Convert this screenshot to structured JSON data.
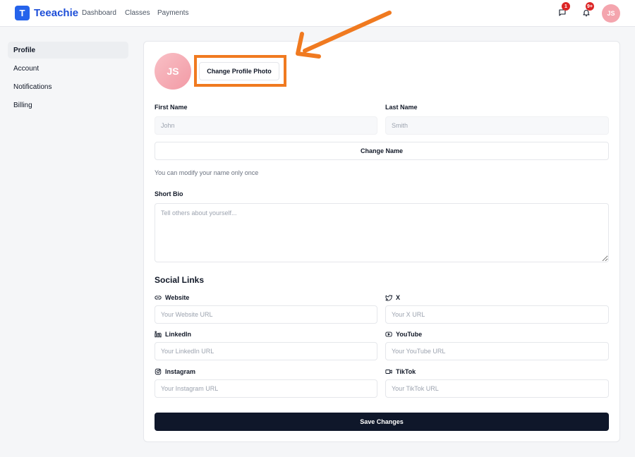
{
  "app": {
    "logo_letter": "T",
    "brand": "Teeachie"
  },
  "nav": {
    "dashboard": "Dashboard",
    "classes": "Classes",
    "payments": "Payments"
  },
  "header": {
    "messages_badge": "1",
    "notifications_badge": "9+",
    "avatar_initials": "JS"
  },
  "sidebar": {
    "items": [
      {
        "label": "Profile",
        "active": true
      },
      {
        "label": "Account",
        "active": false
      },
      {
        "label": "Notifications",
        "active": false
      },
      {
        "label": "Billing",
        "active": false
      }
    ]
  },
  "profile": {
    "avatar_initials": "JS",
    "change_photo_label": "Change Profile Photo",
    "first_name_label": "First Name",
    "first_name_value": "John",
    "last_name_label": "Last Name",
    "last_name_value": "Smith",
    "change_name_label": "Change Name",
    "name_hint": "You can modify your name only once",
    "bio_label": "Short Bio",
    "bio_placeholder": "Tell others about yourself..."
  },
  "social": {
    "title": "Social Links",
    "website": {
      "label": "Website",
      "placeholder": "Your Website URL",
      "icon": "link-icon"
    },
    "x": {
      "label": "X",
      "placeholder": "Your X URL",
      "icon": "twitter-icon"
    },
    "linkedin": {
      "label": "LinkedIn",
      "placeholder": "Your LinkedIn URL",
      "icon": "linkedin-icon"
    },
    "youtube": {
      "label": "YouTube",
      "placeholder": "Your YouTube URL",
      "icon": "youtube-icon"
    },
    "instagram": {
      "label": "Instagram",
      "placeholder": "Your Instagram URL",
      "icon": "instagram-icon"
    },
    "tiktok": {
      "label": "TikTok",
      "placeholder": "Your TikTok URL",
      "icon": "video-icon"
    }
  },
  "save_label": "Save Changes",
  "colors": {
    "brand": "#2563eb",
    "highlight": "#f07a20",
    "save_button": "#0f172a",
    "badge": "#dc2626"
  }
}
